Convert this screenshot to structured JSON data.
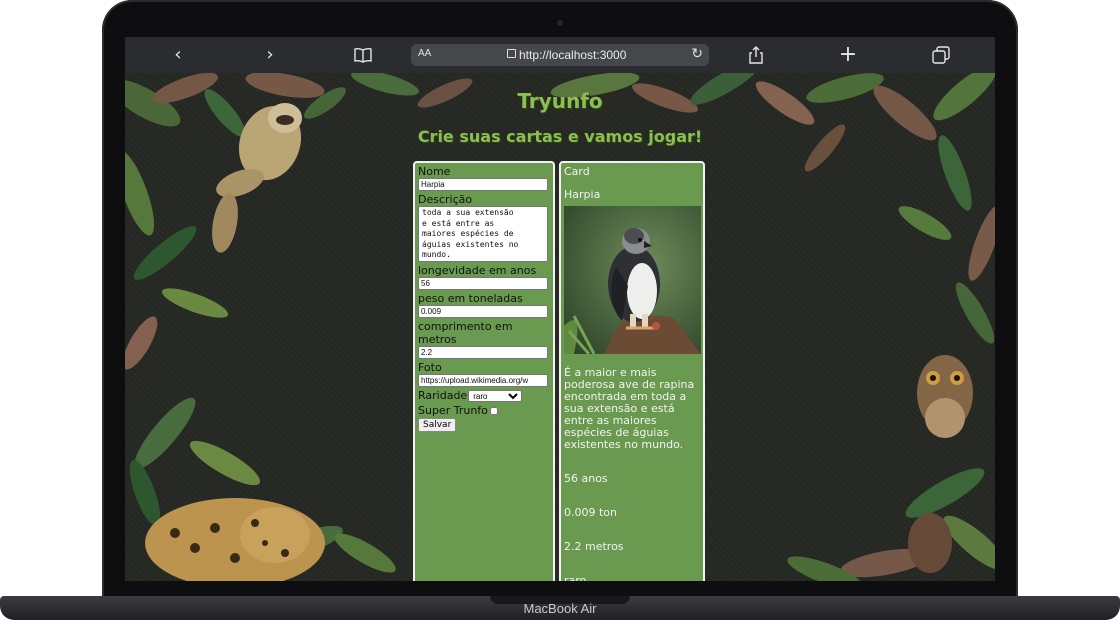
{
  "laptop": {
    "model_label": "MacBook Air"
  },
  "browser": {
    "url": "http://localhost:3000",
    "text_size_label": "AA",
    "buttons": {
      "back": "‹",
      "forward": "›",
      "reload": "↻",
      "new_tab": "+"
    }
  },
  "page": {
    "title": "Tryunfo",
    "subtitle": "Crie suas cartas e vamos jogar!"
  },
  "form": {
    "nome_label": "Nome",
    "nome_value": "Harpia",
    "descricao_label": "Descrição",
    "descricao_value": "toda a sua extensão\ne está entre as\nmaiores espécies de\náguias existentes no\nmundo.",
    "attr1_label": "longevidade em anos",
    "attr1_value": "56",
    "attr2_label": "peso em toneladas",
    "attr2_value": "0.009",
    "attr3_label": "comprimento em metros",
    "attr3_value": "2.2",
    "foto_label": "Foto",
    "foto_value": "https://upload.wikimedia.org/w",
    "raridade_label": "Raridade",
    "raridade_selected": "raro",
    "supertrunfo_label": "Super Trunfo",
    "salvar_label": "Salvar"
  },
  "card": {
    "heading": "Card",
    "name": "Harpia",
    "description": "É a maior e mais poderosa ave de rapina encontrada em toda a sua extensão e está entre as maiores espécies de águias existentes no mundo.",
    "attr1": "56 anos",
    "attr2": "0.009 ton",
    "attr3": "2.2 metros",
    "rarity": "raro"
  },
  "colors": {
    "panel_green": "#6a9a4f",
    "title_green": "#8cbf52",
    "page_background": "#252823"
  }
}
